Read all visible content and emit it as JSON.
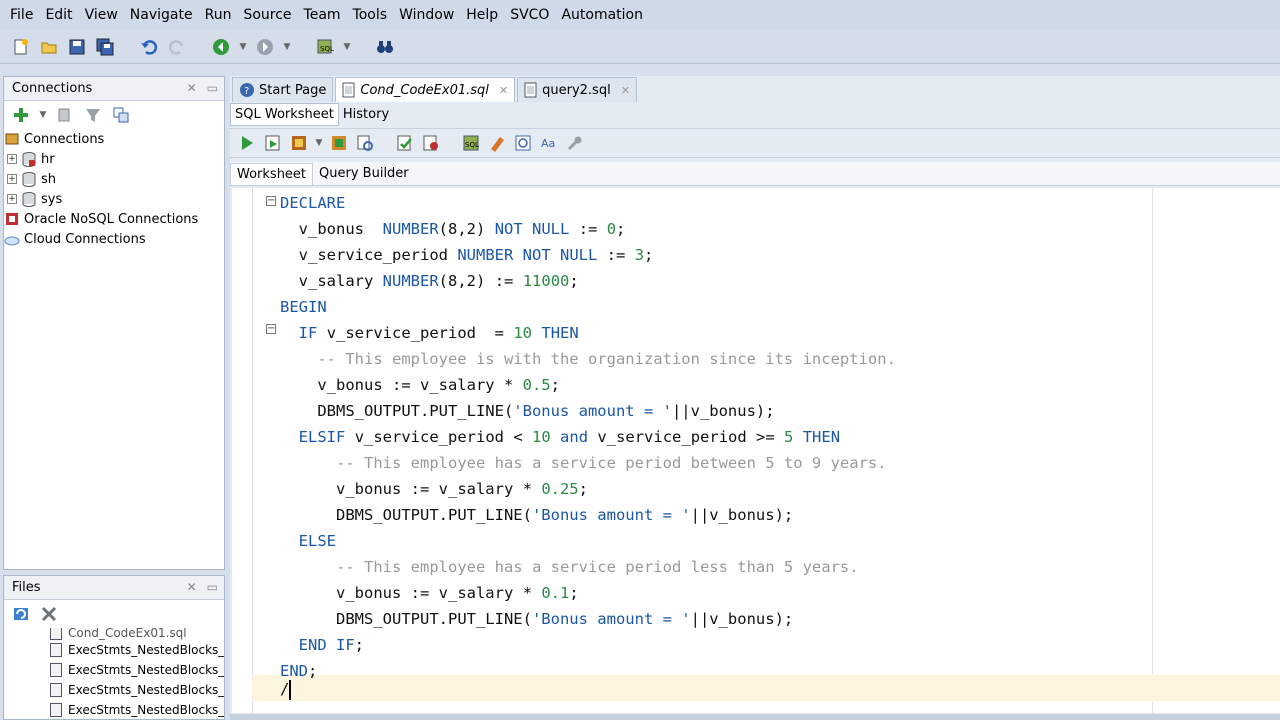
{
  "menu": [
    "File",
    "Edit",
    "View",
    "Navigate",
    "Run",
    "Source",
    "Team",
    "Tools",
    "Window",
    "Help",
    "SVCO",
    "Automation"
  ],
  "connections_panel": {
    "title": "Connections",
    "root_label": "Connections",
    "items": [
      {
        "label": "hr"
      },
      {
        "label": "sh"
      },
      {
        "label": "sys"
      }
    ],
    "nosql_label": "Oracle NoSQL Connections",
    "cloud_label": "Cloud Connections"
  },
  "files_panel": {
    "title": "Files",
    "partial_item": "Cond_CodeEx01.sql",
    "items": [
      "ExecStmts_NestedBlocks_C",
      "ExecStmts_NestedBlocks_C",
      "ExecStmts_NestedBlocks_C",
      "ExecStmts_NestedBlocks_C"
    ]
  },
  "doc_tabs": [
    {
      "label": "Start Page",
      "active": false
    },
    {
      "label": "Cond_CodeEx01.sql",
      "active": true
    },
    {
      "label": "query2.sql",
      "active": false
    }
  ],
  "sub_tabs": [
    "SQL Worksheet",
    "History"
  ],
  "worksheet_tabs": [
    "Worksheet",
    "Query Builder"
  ],
  "code": {
    "l1": "DECLARE",
    "l2": [
      "v_bonus",
      "NUMBER",
      "(8,2)",
      "NOT NULL",
      ":=",
      "0",
      ";"
    ],
    "l3": [
      "v_service_period",
      "NUMBER",
      "NOT NULL",
      ":=",
      "3",
      ";"
    ],
    "l4": [
      "v_salary",
      "NUMBER",
      "(8,2)",
      ":=",
      "11000",
      ";"
    ],
    "l5": "BEGIN",
    "l6": [
      "IF",
      "v_service_period  =",
      "10",
      "THEN"
    ],
    "l7": "-- This employee is with the organization since its inception.",
    "l8": [
      "v_bonus := v_salary * ",
      "0.5",
      ";"
    ],
    "l9": [
      "DBMS_OUTPUT.PUT_LINE(",
      "'Bonus amount = '",
      "||v_bonus);"
    ],
    "l10": [
      "ELSIF",
      "v_service_period <",
      "10",
      "and",
      "v_service_period >=",
      "5",
      "THEN"
    ],
    "l11": "-- This employee has a service period between 5 to 9 years.",
    "l12": [
      "v_bonus := v_salary * ",
      "0.25",
      ";"
    ],
    "l13": [
      "DBMS_OUTPUT.PUT_LINE(",
      "'Bonus amount = '",
      "||v_bonus);"
    ],
    "l14": "ELSE",
    "l15": "-- This employee has a service period less than 5 years.",
    "l16": [
      "v_bonus := v_salary * ",
      "0.1",
      ";"
    ],
    "l17": [
      "DBMS_OUTPUT.PUT_LINE(",
      "'Bonus amount = '",
      "||v_bonus);"
    ],
    "l18": [
      "END IF",
      ";"
    ],
    "l19": [
      "END",
      ";"
    ],
    "l20": "/"
  },
  "colors": {
    "keyword": "#1c56a8",
    "number": "#2a8a45",
    "comment": "#9a9a9a",
    "current_line": "#fdf5e0"
  }
}
